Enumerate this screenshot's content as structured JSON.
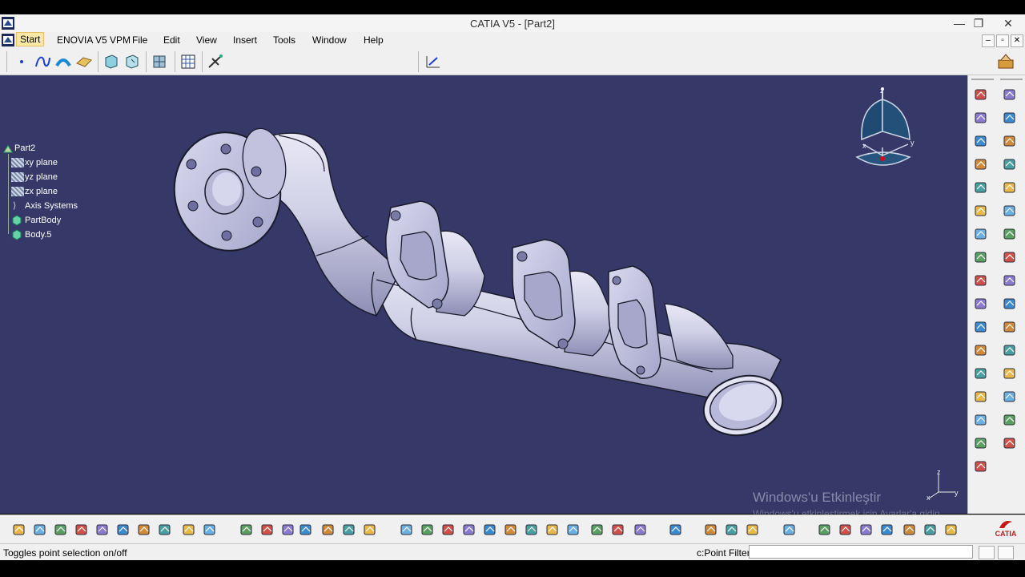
{
  "window": {
    "title": "CATIA V5 - [Part2]",
    "minimize": "—",
    "restore": "❐",
    "close": "✕",
    "doc_minimize": "–",
    "doc_restore": "▫",
    "doc_close": "✕"
  },
  "menu": {
    "items": [
      "Start",
      "ENOVIA V5 VPM",
      "File",
      "Edit",
      "View",
      "Insert",
      "Tools",
      "Window",
      "Help"
    ]
  },
  "tree": {
    "root": "Part2",
    "items": [
      "xy plane",
      "yz plane",
      "zx plane",
      "Axis Systems",
      "PartBody",
      "Body.5"
    ]
  },
  "compass": {
    "x": "x",
    "y": "y",
    "z": "z"
  },
  "axis_triad": {
    "x": "x",
    "y": "y",
    "z": "z"
  },
  "watermark": {
    "line1": "Windows'u Etkinleştir",
    "line2": "Windows'u etkinleştirmek için Ayarlar'a gidin."
  },
  "logo": "CATIA",
  "status": {
    "message": "Toggles point selection on/off",
    "filter_label": "c:Point Filter",
    "filter_value": ""
  },
  "colors": {
    "viewport_bg": "#363868",
    "part_fill": "#c9c9e3",
    "toolbar_bg": "#f0f0f0",
    "menu_highlight": "#fbe7a6"
  },
  "toolbars": {
    "top_icons": [
      "point-icon",
      "spline-icon",
      "sweep-icon",
      "surface-icon",
      "extract-icon",
      "join-icon",
      "tools-icon",
      "grid-icon",
      "measure-icon",
      "sketcher-icon",
      "workbench-icon"
    ],
    "right_icons": [
      "pad-icon",
      "pocket-icon",
      "shaft-icon",
      "hole-icon",
      "rib-icon",
      "slot-icon",
      "fillet-icon",
      "chamfer-icon",
      "draft-icon",
      "shell-icon",
      "thickness-icon",
      "thread-icon",
      "split-icon",
      "thick-surface-icon",
      "close-surface-icon",
      "sew-icon",
      "translate-icon",
      "rotate-icon",
      "symmetry-icon",
      "mirror-icon",
      "pattern-icon",
      "scale-icon",
      "boolean-icon",
      "constraint-icon",
      "analysis-icon",
      "sketch-icon",
      "reference-point-icon",
      "line-icon",
      "plane-icon",
      "axis-icon",
      "measure-item-icon",
      "apply-material-icon",
      "catalog-icon"
    ],
    "bottom_icons": [
      "new-icon",
      "open-icon",
      "save-icon",
      "print-icon",
      "cut-icon",
      "copy-icon",
      "paste-icon",
      "undo-icon",
      "redo-icon",
      "whats-this-icon",
      "formula-icon",
      "comment-icon",
      "law-icon",
      "table-icon",
      "knowledge-icon",
      "reaction-icon",
      "check-icon",
      "fly-mode-icon",
      "fit-all-icon",
      "pan-icon",
      "rotate-view-icon",
      "zoom-in-icon",
      "zoom-out-icon",
      "normal-view-icon",
      "quick-view-icon",
      "iso-view-icon",
      "shading-icon",
      "hide-show-icon",
      "swap-space-icon",
      "update-icon",
      "select-icon",
      "scan-icon",
      "ruler-icon",
      "capture-icon",
      "snap-icon",
      "grab-icon",
      "axis-icon-small",
      "measure-between-icon",
      "measure-item-small",
      "tolerance-icon",
      "tools-palette-icon"
    ]
  }
}
